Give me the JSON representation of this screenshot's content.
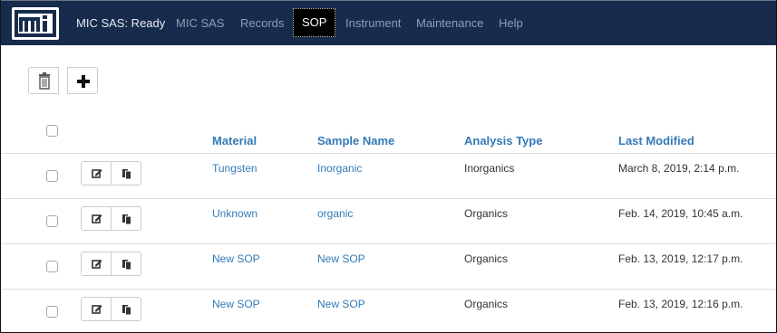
{
  "header": {
    "logo_icon": "mi-logo-icon",
    "brand": "MIC SAS: Ready",
    "nav": [
      {
        "label": "MIC SAS"
      },
      {
        "label": "Records"
      },
      {
        "label": "SOP",
        "active": true
      },
      {
        "label": "Instrument"
      },
      {
        "label": "Maintenance"
      },
      {
        "label": "Help"
      }
    ]
  },
  "toolbar": {
    "delete_icon": "trash-icon",
    "add_icon": "plus-icon"
  },
  "table": {
    "headers": [
      "Material",
      "Sample Name",
      "Analysis Type",
      "Last Modified"
    ],
    "rows": [
      {
        "material": "Tungsten",
        "sample_name": "Inorganic",
        "analysis_type": "Inorganics",
        "last_modified": "March 8, 2019, 2:14 p.m."
      },
      {
        "material": "Unknown",
        "sample_name": "organic",
        "analysis_type": "Organics",
        "last_modified": "Feb. 14, 2019, 10:45 a.m."
      },
      {
        "material": "New SOP",
        "sample_name": "New SOP",
        "analysis_type": "Organics",
        "last_modified": "Feb. 13, 2019, 12:17 p.m."
      },
      {
        "material": "New SOP",
        "sample_name": "New SOP",
        "analysis_type": "Organics",
        "last_modified": "Feb. 13, 2019, 12:16 p.m."
      }
    ],
    "row_icons": {
      "edit": "edit-icon",
      "copy": "copy-icon"
    }
  },
  "colors": {
    "navbar": "#172b4d",
    "link": "#337ab7",
    "text": "#333333"
  }
}
